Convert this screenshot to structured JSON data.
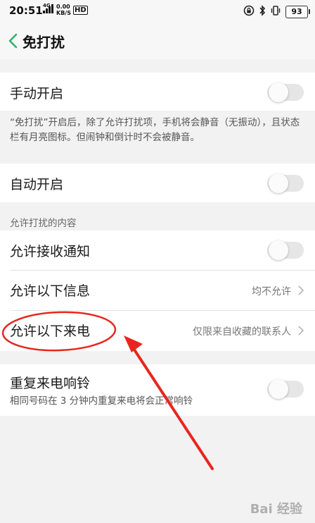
{
  "status_bar": {
    "time": "20:51",
    "network_type": "4G",
    "speed_value": "0.00",
    "speed_unit": "KB/S",
    "hd_label": "HD",
    "battery": "93"
  },
  "header": {
    "title": "免打扰"
  },
  "manual": {
    "label": "手动开启",
    "description": "“免打扰”开启后，除了允许打扰项，手机将会静音（无振动），且状态栏有月亮图标。但闹钟和倒计时不会被静音。"
  },
  "auto": {
    "label": "自动开启"
  },
  "allowed_section": {
    "title": "允许打扰的内容",
    "items": [
      {
        "label": "允许接收通知"
      },
      {
        "label": "允许以下信息",
        "value": "均不允许"
      },
      {
        "label": "允许以下来电",
        "value": "仅限来自收藏的联系人"
      }
    ]
  },
  "repeat": {
    "label": "重复来电响铃",
    "sub": "相同号码在 3 分钟内重复来电将会正常响铃"
  },
  "watermark": "Bai 经验",
  "colors": {
    "accent_green": "#2db46f",
    "annotation_red": "#e8261f"
  }
}
